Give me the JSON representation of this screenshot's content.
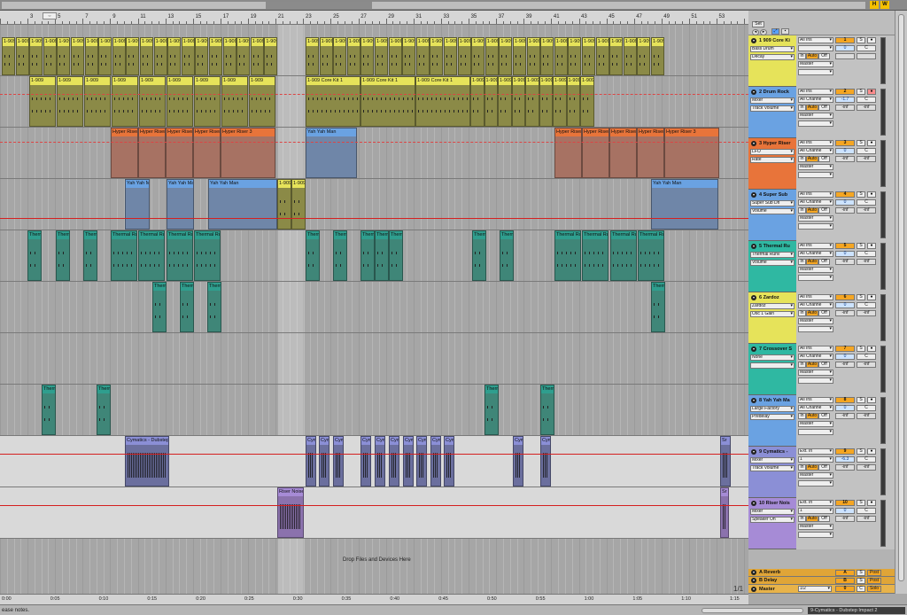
{
  "overview": {
    "hot_swap_label": "H",
    "w_label": "W"
  },
  "ruler": {
    "bar_labels": [
      "3",
      "5",
      "7",
      "9",
      "11",
      "13",
      "15",
      "17",
      "19",
      "21",
      "23",
      "25",
      "27",
      "29",
      "31",
      "33",
      "35",
      "37",
      "39",
      "41",
      "43",
      "45",
      "47",
      "49",
      "51",
      "53"
    ]
  },
  "timeline": {
    "labels": [
      "0:00",
      "0:05",
      "0:10",
      "0:15",
      "0:20",
      "0:25",
      "0:30",
      "0:35",
      "0:40",
      "0:45",
      "0:50",
      "0:55",
      "1:00",
      "1:05",
      "1:10",
      "1:15"
    ]
  },
  "page_counter": "1/1",
  "drop_zone_text": "Drop Files and Devices Here",
  "set_button": "Set",
  "colors": {
    "drum": "#e6e35a",
    "drum_body": "#8b8a47",
    "riser": "#e8743a",
    "riser_body": "#a77263",
    "blue_clip": "#6aa2e2",
    "blue_body": "#6f86a8",
    "teal": "#2f9e8e",
    "teal_body": "#3f8678",
    "cymatics": "#8b8fd6",
    "cymatics_body": "#6b6f9e",
    "riser_noise": "#a68bd6",
    "envelope": "#d42020",
    "orange_button": "#f5a623"
  },
  "tracks": [
    {
      "num": "1",
      "title": "1 909 Core Ki",
      "color": "#e6e35a",
      "input": "All Ins",
      "chain": "Bass Drum",
      "param": "Decay",
      "ins_ch": "",
      "monitor": "",
      "out": "Master",
      "vol": "0",
      "pan": "C",
      "s": "S",
      "arm": "●",
      "in": "In",
      "auto": "Auto",
      "off": "Off",
      "inf1": "",
      "inf2": ""
    },
    {
      "num": "2",
      "title": "2 Drum Rock",
      "color": "#6aa2e2",
      "input": "All Ins",
      "chain": "Mixer",
      "param": "Track Volume",
      "ins_ch": "All Channe",
      "monitor": "Auto",
      "out": "Master",
      "vol": "-1.7",
      "pan": "C",
      "s": "S",
      "arm": "●",
      "in": "In",
      "auto": "Auto",
      "off": "Off",
      "inf1": "-inf",
      "inf2": "-inf"
    },
    {
      "num": "3",
      "title": "3 Hyper Riser",
      "color": "#e8743a",
      "input": "All Ins",
      "chain": "LFO",
      "param": "Rate",
      "ins_ch": "All Channe",
      "monitor": "Auto",
      "out": "Master",
      "vol": "0",
      "pan": "C",
      "s": "S",
      "arm": "●",
      "in": "In",
      "auto": "Auto",
      "off": "Off",
      "inf1": "-inf",
      "inf2": "-inf"
    },
    {
      "num": "4",
      "title": "4 Super Sub",
      "color": "#6aa2e2",
      "input": "All Ins",
      "chain": "Super Sub Dri",
      "param": "Volume",
      "ins_ch": "All Channe",
      "monitor": "Auto",
      "out": "Master",
      "vol": "0",
      "pan": "C",
      "s": "S",
      "arm": "●",
      "in": "In",
      "auto": "Auto",
      "off": "Off",
      "inf1": "-inf",
      "inf2": "-inf"
    },
    {
      "num": "5",
      "title": "5 Thermal Ru",
      "color": "#2fb8a2",
      "input": "All Ins",
      "chain": "Thermal Runv",
      "param": "Volume",
      "ins_ch": "All Channe",
      "monitor": "Auto",
      "out": "Master",
      "vol": "0",
      "pan": "C",
      "s": "S",
      "arm": "●",
      "in": "In",
      "auto": "Auto",
      "off": "Off",
      "inf1": "-inf",
      "inf2": "-inf"
    },
    {
      "num": "6",
      "title": "6 Zardoz",
      "color": "#e6e35a",
      "input": "All Ins",
      "chain": "Zardoz",
      "param": "Osc 1 Gain",
      "ins_ch": "All Channe",
      "monitor": "Auto",
      "out": "Master",
      "vol": "0",
      "pan": "C",
      "s": "S",
      "arm": "●",
      "in": "In",
      "auto": "Auto",
      "off": "Off",
      "inf1": "-inf",
      "inf2": "-inf"
    },
    {
      "num": "7",
      "title": "7 Crossover S",
      "color": "#2fb8a2",
      "input": "All Ins",
      "chain": "None",
      "param": "",
      "ins_ch": "All Channe",
      "monitor": "Auto",
      "out": "Master",
      "vol": "0",
      "pan": "C",
      "s": "S",
      "arm": "●",
      "in": "In",
      "auto": "Auto",
      "off": "Off",
      "inf1": "-inf",
      "inf2": "-inf"
    },
    {
      "num": "8",
      "title": "8 Yah Yah Ma",
      "color": "#6aa2e2",
      "input": "All Ins",
      "chain": "Large Factory",
      "param": "Predelay",
      "ins_ch": "All Channe",
      "monitor": "Auto",
      "out": "Master",
      "vol": "0",
      "pan": "C",
      "s": "S",
      "arm": "●",
      "in": "In",
      "auto": "Auto",
      "off": "Off",
      "inf1": "-inf",
      "inf2": "-inf"
    },
    {
      "num": "9",
      "title": "9 Cymatics -",
      "color": "#8b8fd6",
      "input": "Ext. In",
      "chain": "Mixer",
      "param": "Track Volume",
      "ins_ch": "1",
      "monitor": "Auto",
      "out": "Master",
      "vol": "-6.3",
      "pan": "C",
      "s": "S",
      "arm": "●",
      "in": "In",
      "auto": "Auto",
      "off": "Off",
      "inf1": "-inf",
      "inf2": "-inf"
    },
    {
      "num": "10",
      "title": "10 Riser Nois",
      "color": "#a68bd6",
      "input": "Ext. In",
      "chain": "Mixer",
      "param": "Speaker On",
      "ins_ch": "1",
      "monitor": "Auto",
      "out": "Master",
      "vol": "0",
      "pan": "C",
      "s": "S",
      "arm": "●",
      "in": "In",
      "auto": "Auto",
      "off": "Off",
      "inf1": "-inf",
      "inf2": "-inf"
    }
  ],
  "returns": [
    {
      "title": "A Reverb",
      "letter": "A",
      "s": "S",
      "post": "Post"
    },
    {
      "title": "B Delay",
      "letter": "B",
      "s": "S",
      "post": "Post"
    }
  ],
  "master": {
    "title": "Master",
    "input": "1/2",
    "vol": "0",
    "pan": "C",
    "solo": "Solo"
  },
  "clips": {
    "t1": [
      "1-909",
      "1-909",
      "1-909",
      "1-909",
      "1-909",
      "1-909",
      "1-909",
      "1-909",
      "1-909",
      "1-909",
      "1-909",
      "1-909",
      "1-909",
      "1-909",
      "1-909",
      "1-909",
      "1-909",
      "1-909",
      "1-909",
      "1-909",
      "1-909",
      "1-909",
      "1-909",
      "1-909",
      "1-909",
      "1-909",
      "1-909",
      "1-909",
      "1-909",
      "1-909",
      "1-909",
      "1-909",
      "1-909",
      "1-909",
      "1-909",
      "1-909",
      "1-909",
      "1-909",
      "1-909",
      "1-909",
      "1-909",
      "1-909",
      "1-909",
      "1-909",
      "1-909",
      "1-909"
    ],
    "t2a": [
      "1-909",
      "1-909",
      "1-909",
      "1-909",
      "1-909",
      "1-909",
      "1-909",
      "1-909",
      "1-909"
    ],
    "t2b": [
      "1-909 Core Kit 1",
      "1-909 Core Kit 1",
      "1-909 Core Kit 1",
      "1-909",
      "1-909",
      "1-909",
      "1-909",
      "1-909",
      "1-909",
      "1-909",
      "1-909",
      "1-909"
    ],
    "t3a": [
      "Hyper Riser",
      "Hyper Riser",
      "Hyper Riser",
      "Hyper Riser",
      "Hyper Riser 3"
    ],
    "t3mid": "Yah Yah Man",
    "t3b": [
      "Hyper Riser",
      "Hyper Riser",
      "Hyper Riser",
      "Hyper Riser",
      "Hyper Riser 3"
    ],
    "t4a": [
      "Yah Yah Man",
      "Yah Yah Man",
      "Yah Yah Man"
    ],
    "t4b": [
      "1-909",
      "1-909"
    ],
    "t4c": "Yah Yah Man",
    "thermal": "Thermal Ru",
    "zardoz": "Therr",
    "t8": "Therr",
    "cymatics_long": "Cymatics - Dubstep",
    "cym_short": "Cym",
    "riser_noise": "Riser Noise",
    "sr": "Sr"
  },
  "status": {
    "text": "ease notes.",
    "track_name": "9-Cymatics - Dubstep Impact 2"
  }
}
